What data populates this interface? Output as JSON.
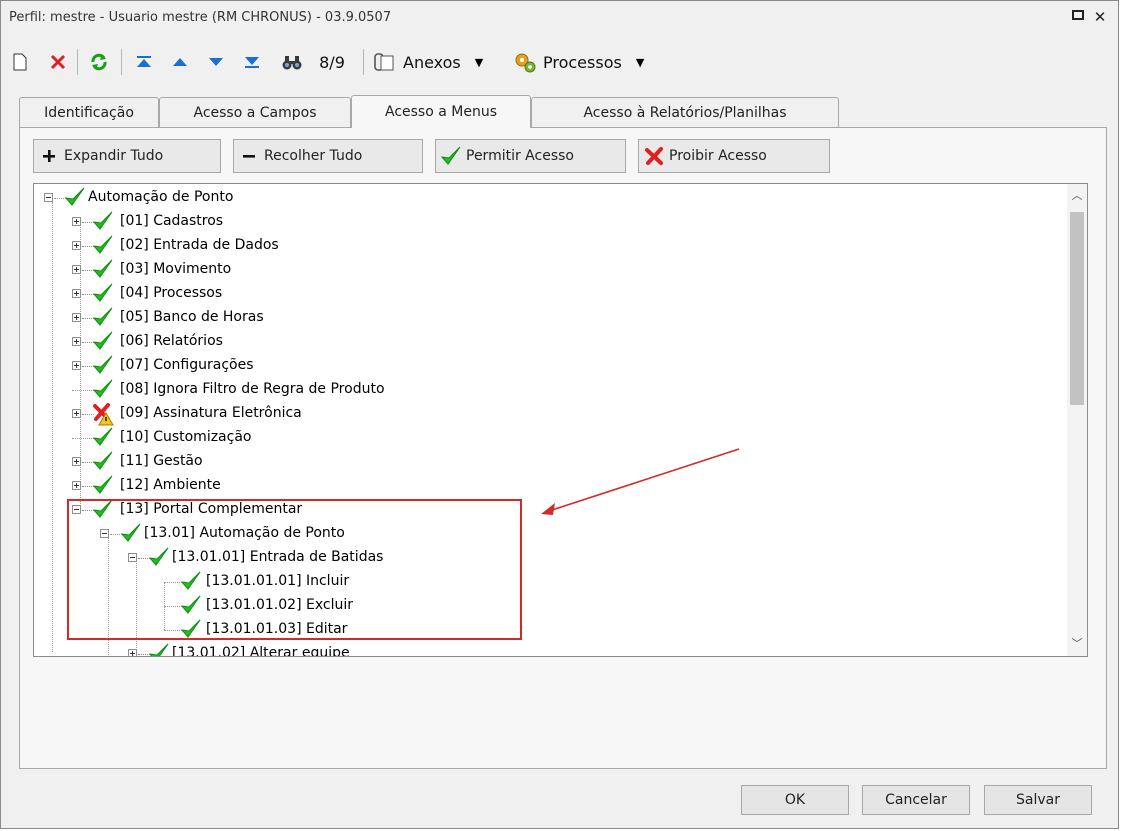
{
  "window": {
    "title": "Perfil: mestre - Usuario mestre (RM CHRONUS) - 03.9.0507"
  },
  "toolbar": {
    "record_counter": "8/9",
    "anexos_label": "Anexos",
    "processos_label": "Processos"
  },
  "tabs": [
    {
      "label": "Identificação"
    },
    {
      "label": "Acesso a Campos"
    },
    {
      "label": "Acesso a Menus"
    },
    {
      "label": "Acesso à Relatórios/Planilhas"
    }
  ],
  "actions": {
    "expand_all": "Expandir Tudo",
    "collapse_all": "Recolher Tudo",
    "allow_access": "Permitir Acesso",
    "deny_access": "Proibir Acesso"
  },
  "tree": {
    "root": "Automação de Ponto",
    "items": [
      {
        "label": "[01] Cadastros",
        "state": "allowed"
      },
      {
        "label": "[02] Entrada de Dados",
        "state": "allowed"
      },
      {
        "label": "[03] Movimento",
        "state": "allowed"
      },
      {
        "label": "[04] Processos",
        "state": "allowed"
      },
      {
        "label": "[05] Banco de Horas",
        "state": "allowed"
      },
      {
        "label": "[06] Relatórios",
        "state": "allowed"
      },
      {
        "label": "[07] Configurações",
        "state": "allowed"
      },
      {
        "label": "[08] Ignora Filtro de Regra de Produto",
        "state": "allowed"
      },
      {
        "label": "[09] Assinatura Eletrônica",
        "state": "partial"
      },
      {
        "label": "[10] Customização",
        "state": "allowed"
      },
      {
        "label": "[11] Gestão",
        "state": "allowed"
      },
      {
        "label": "[12] Ambiente",
        "state": "allowed"
      },
      {
        "label": "[13] Portal Complementar",
        "state": "allowed"
      }
    ],
    "portal": {
      "l2": "[13.01] Automação de Ponto",
      "l3": "[13.01.01] Entrada de Batidas",
      "l4": [
        "[13.01.01.01] Incluir",
        "[13.01.01.02] Excluir",
        "[13.01.01.03] Editar"
      ],
      "next": "[13.01.02] Alterar equipe"
    }
  },
  "footer": {
    "ok": "OK",
    "cancel": "Cancelar",
    "save": "Salvar"
  },
  "colors": {
    "highlight": "#d12a2a",
    "check": "#1fc01f",
    "deny": "#e02020"
  }
}
